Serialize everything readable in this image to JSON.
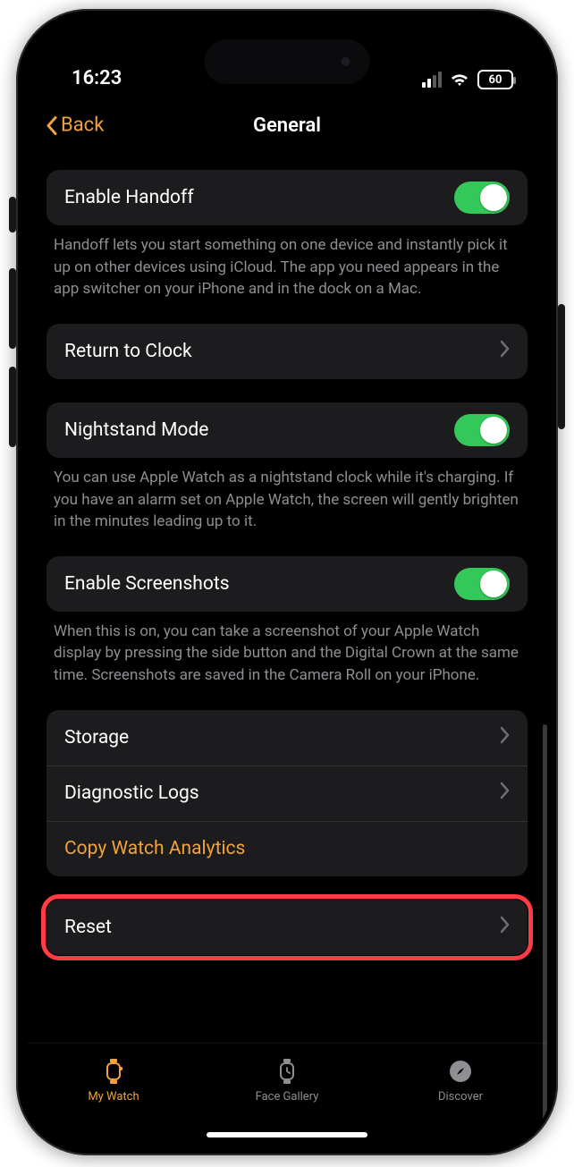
{
  "status": {
    "time": "16:23",
    "battery": "60"
  },
  "nav": {
    "back": "Back",
    "title": "General"
  },
  "rows": {
    "handoff": {
      "label": "Enable Handoff",
      "description": "Handoff lets you start something on one device and instantly pick it up on other devices using iCloud. The app you need appears in the app switcher on your iPhone and in the dock on a Mac."
    },
    "return_clock": {
      "label": "Return to Clock"
    },
    "nightstand": {
      "label": "Nightstand Mode",
      "description": "You can use Apple Watch as a nightstand clock while it's charging. If you have an alarm set on Apple Watch, the screen will gently brighten in the minutes leading up to it."
    },
    "screenshots": {
      "label": "Enable Screenshots",
      "description": "When this is on, you can take a screenshot of your Apple Watch display by pressing the side button and the Digital Crown at the same time. Screenshots are saved in the Camera Roll on your iPhone."
    },
    "storage": {
      "label": "Storage"
    },
    "logs": {
      "label": "Diagnostic Logs"
    },
    "analytics": {
      "label": "Copy Watch Analytics"
    },
    "reset": {
      "label": "Reset"
    }
  },
  "tabs": {
    "mywatch": "My Watch",
    "gallery": "Face Gallery",
    "discover": "Discover"
  }
}
